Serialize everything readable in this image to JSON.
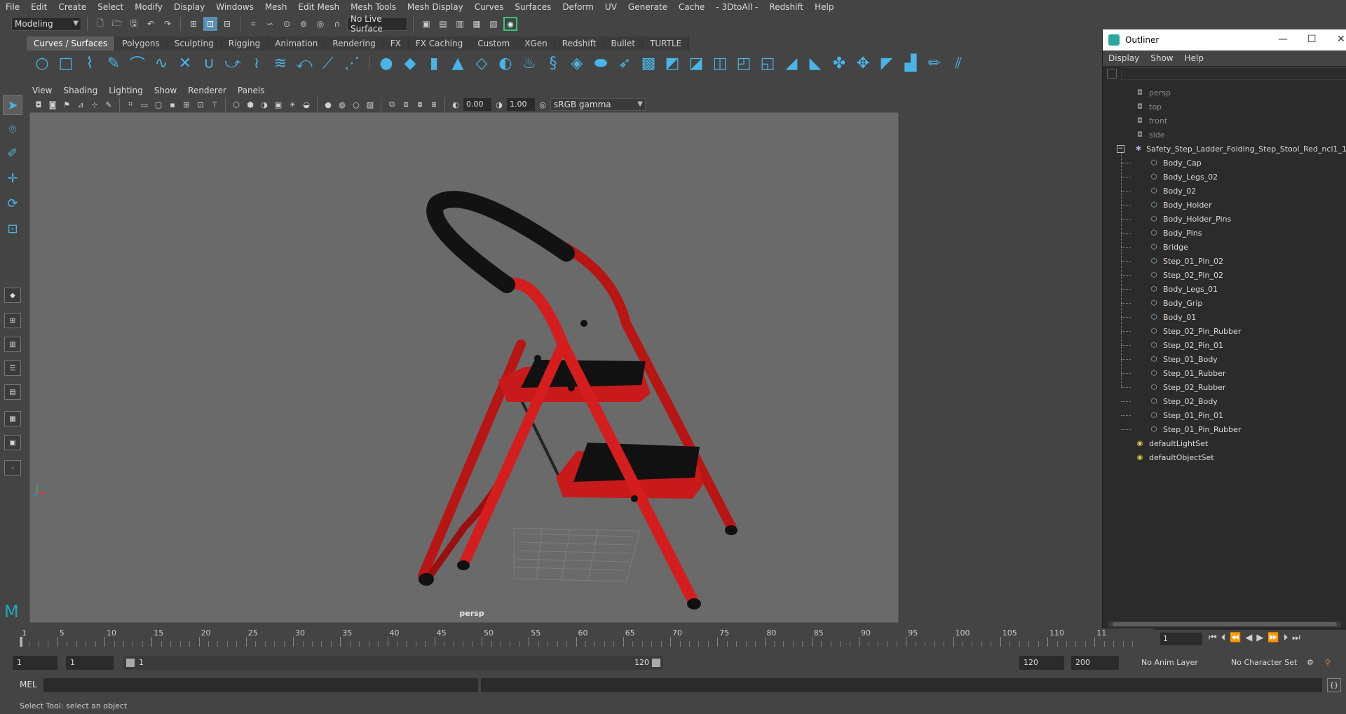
{
  "menubar": [
    "File",
    "Edit",
    "Create",
    "Select",
    "Modify",
    "Display",
    "Windows",
    "Mesh",
    "Edit Mesh",
    "Mesh Tools",
    "Mesh Display",
    "Curves",
    "Surfaces",
    "Deform",
    "UV",
    "Generate",
    "Cache",
    "- 3DtoAll -",
    "Redshift",
    "Help"
  ],
  "statusline": {
    "mode": "Modeling",
    "live_surface": "No Live Surface"
  },
  "shelf_tabs": [
    "Curves / Surfaces",
    "Polygons",
    "Sculpting",
    "Rigging",
    "Animation",
    "Rendering",
    "FX",
    "FX Caching",
    "Custom",
    "XGen",
    "Redshift",
    "Bullet",
    "TURTLE"
  ],
  "shelf_active": "Curves / Surfaces",
  "panel_menu": [
    "View",
    "Shading",
    "Lighting",
    "Show",
    "Renderer",
    "Panels"
  ],
  "panel_toolbar": {
    "exposure": "0.00",
    "gamma": "1.00",
    "colorspace": "sRGB gamma"
  },
  "viewport": {
    "camera": "persp",
    "colors": {
      "background": "#6a6a6a",
      "frame_red": "#c81a1a",
      "grip_black": "#111111"
    }
  },
  "outliner": {
    "title": "Outliner",
    "menu": [
      "Display",
      "Show",
      "Help"
    ],
    "cameras": [
      "persp",
      "top",
      "front",
      "side"
    ],
    "group": "Safety_Step_Ladder_Folding_Step_Stool_Red_ncl1_1",
    "children": [
      "Body_Cap",
      "Body_Legs_02",
      "Body_02",
      "Body_Holder",
      "Body_Holder_Pins",
      "Body_Pins",
      "Bridge",
      "Step_01_Pin_02",
      "Step_02_Pin_02",
      "Body_Legs_01",
      "Body_Grip",
      "Body_01",
      "Step_02_Pin_Rubber",
      "Step_02_Pin_01",
      "Step_01_Body",
      "Step_01_Rubber",
      "Step_02_Rubber",
      "Step_02_Body",
      "Step_01_Pin_01",
      "Step_01_Pin_Rubber"
    ],
    "sets": [
      "defaultLightSet",
      "defaultObjectSet"
    ]
  },
  "timeslider": {
    "labels": [
      "1",
      "5",
      "10",
      "15",
      "20",
      "25",
      "30",
      "35",
      "40",
      "45",
      "50",
      "55",
      "60",
      "65",
      "70",
      "75",
      "80",
      "85",
      "90",
      "95",
      "100",
      "105",
      "110",
      "11"
    ],
    "current_frame": "1"
  },
  "range": {
    "start": "1",
    "playback_start": "1",
    "slider_start": "1",
    "slider_end": "120",
    "playback_end": "120",
    "end": "200",
    "anim_layer": "No Anim Layer",
    "character_set": "No Character Set"
  },
  "cmdline": {
    "label": "MEL"
  },
  "helpline": "Select Tool: select an object"
}
